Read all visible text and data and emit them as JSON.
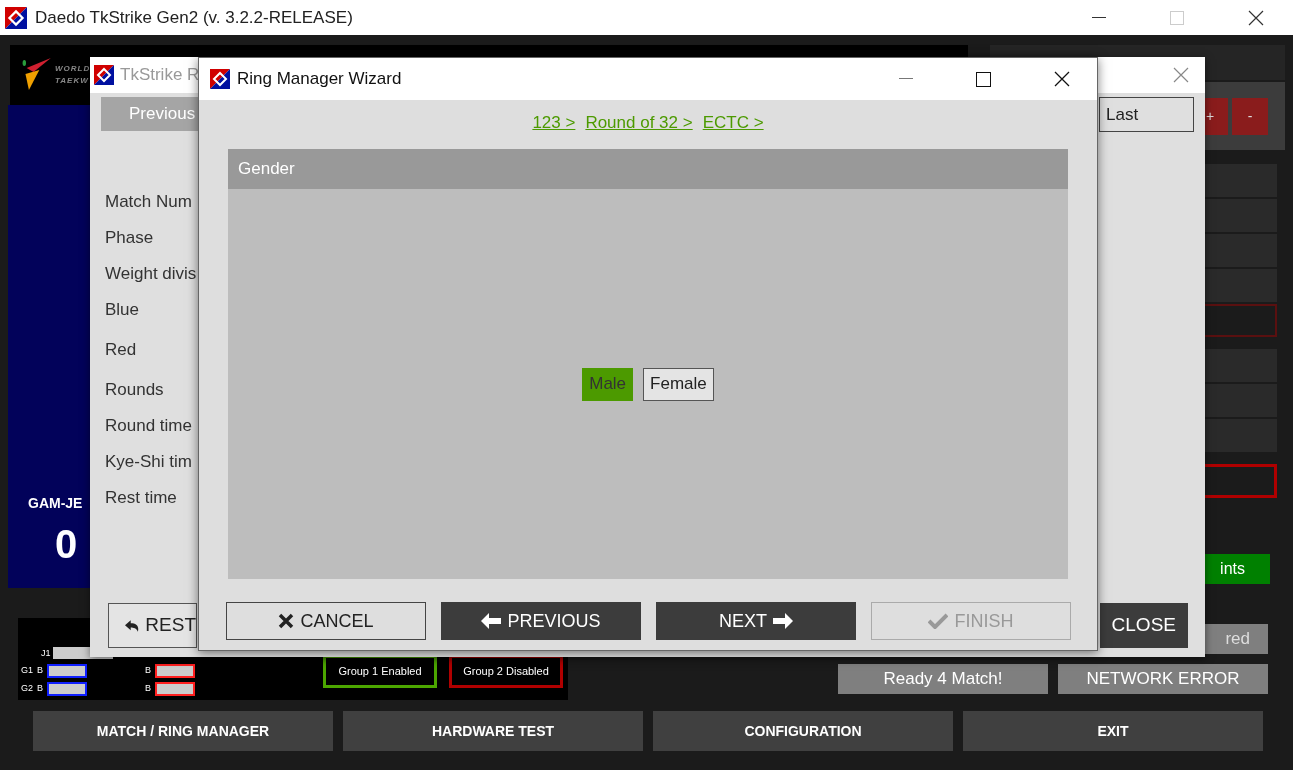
{
  "window": {
    "title": "Daedo TkStrike Gen2 (v. 3.2.2-RELEASE)"
  },
  "logo": {
    "lines": [
      "WORLD",
      "TAEKW"
    ]
  },
  "scoreboard": {
    "label": "GAM-JE",
    "value": "0"
  },
  "right_panel": {
    "score_buttons": [
      "+",
      "-"
    ],
    "green_button": "ints",
    "status": "red"
  },
  "sensors": {
    "judges": [
      {
        "label": "J1"
      }
    ],
    "groups": [
      {
        "label": "G1",
        "blue": "B",
        "red": "B"
      },
      {
        "label": "G2",
        "blue": "B",
        "red": "B"
      }
    ],
    "group_states": [
      {
        "label": "Group 1 Enabled",
        "color": "#4ca600"
      },
      {
        "label": "Group 2 Disabled",
        "color": "#b00000"
      }
    ]
  },
  "status_buttons": [
    "Ready 4 Match!",
    "NETWORK ERROR"
  ],
  "nav": [
    "MATCH / RING MANAGER",
    "HARDWARE TEST",
    "CONFIGURATION",
    "EXIT"
  ],
  "back_dialog": {
    "title": "TkStrike R",
    "previous": "Previous",
    "last": "Last",
    "fields": [
      "Match Num",
      "Phase",
      "Weight divis",
      "Blue",
      "Red",
      "Rounds",
      "Round time",
      "Kye-Shi tim",
      "Rest time"
    ],
    "rest": "REST",
    "close": "CLOSE"
  },
  "wizard": {
    "title": "Ring Manager Wizard",
    "breadcrumbs": [
      "123 >",
      "Round of 32 >",
      "ECTC >"
    ],
    "section": "Gender",
    "options": [
      {
        "label": "Male",
        "selected": true
      },
      {
        "label": "Female",
        "selected": false
      }
    ],
    "buttons": [
      {
        "label": "CANCEL",
        "kind": "cancel",
        "disabled": false
      },
      {
        "label": "PREVIOUS",
        "kind": "previous",
        "disabled": false
      },
      {
        "label": "NEXT",
        "kind": "next",
        "disabled": false
      },
      {
        "label": "FINISH",
        "kind": "finish",
        "disabled": true
      }
    ]
  }
}
